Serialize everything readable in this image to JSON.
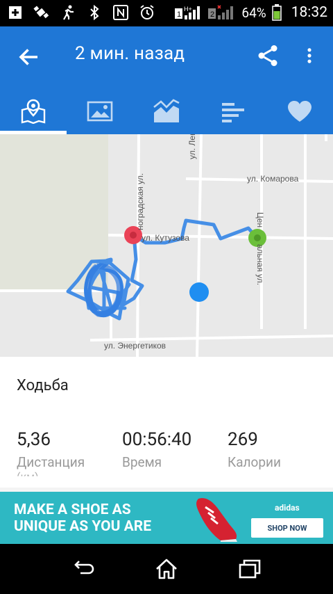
{
  "status_bar": {
    "battery_percent": "64%",
    "time": "18:32",
    "sim1": "1",
    "sim2": "2",
    "network": "H+"
  },
  "appbar": {
    "title": "2 мин. назад",
    "bg_color": "#1f77d6"
  },
  "tabs": [
    {
      "icon": "map-icon",
      "active": true
    },
    {
      "icon": "photo-icon",
      "active": false
    },
    {
      "icon": "chart-icon",
      "active": false
    },
    {
      "icon": "splits-icon",
      "active": false
    },
    {
      "icon": "heart-icon",
      "active": false
    }
  ],
  "map": {
    "streets": {
      "komarova": "ул. Комарова",
      "kutuzova": "ул. Кутузова",
      "energetikov": "ул. Энергетиков",
      "lenina": "ул. Ленина",
      "vinogradskaya": "ноградская ул.",
      "tsentralnaya_top": "Цен",
      "tsentralnaya_bottom": "альная ул."
    },
    "markers": {
      "start_color": "#6bbf3a",
      "end_color": "#ea4357",
      "location_color": "#1f8ef1"
    }
  },
  "activity": {
    "type": "Ходьба",
    "distance_value": "5,36",
    "distance_label": "Дистанция",
    "time_value": "00:56:40",
    "time_label": "Время",
    "calories_value": "269",
    "calories_label": "Калории",
    "cut_text": "(км)"
  },
  "ad": {
    "line1": "MAKE A SHOE AS",
    "line2": "UNIQUE AS YOU ARE",
    "brand": "adidas",
    "cta": "SHOP NOW"
  }
}
